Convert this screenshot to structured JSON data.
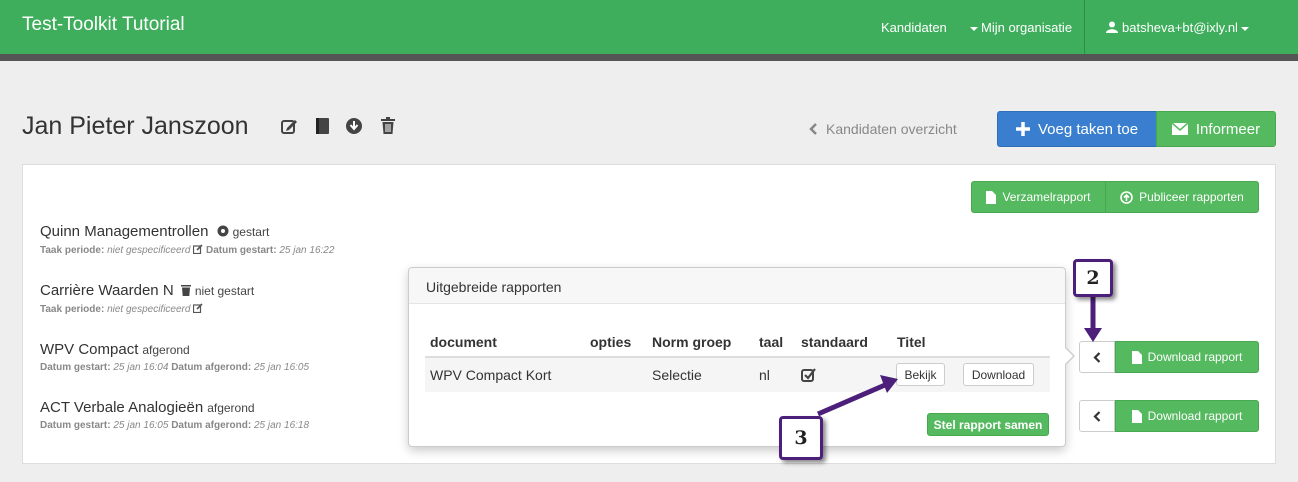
{
  "navbar": {
    "brand": "Test-Toolkit Tutorial",
    "links": {
      "kandidaten": "Kandidaten",
      "organisatie": "Mijn organisatie",
      "user": "batsheva+bt@ixly.nl"
    },
    "color": "#3eae5c"
  },
  "header": {
    "candidate_name": "Jan Pieter Janszoon",
    "icons": [
      "edit-icon",
      "book-icon",
      "download-circle-icon",
      "trash-icon"
    ],
    "back_link": "Kandidaten overzicht",
    "add_tasks_label": "Voeg taken toe",
    "inform_label": "Informeer"
  },
  "panel": {
    "verzamelrapport_label": "Verzamelrapport",
    "publish_label": "Publiceer rapporten",
    "tasks": [
      {
        "title": "Quinn Managementrollen",
        "status": "gestart",
        "meta_1_label": "Taak periode:",
        "meta_1_value": "niet gespecificeerd",
        "meta_2_label": "Datum gestart:",
        "meta_2_value": "25 jan 16:22"
      },
      {
        "title": "Carrière Waarden N",
        "status": "niet gestart",
        "meta_1_label": "Taak periode:",
        "meta_1_value": "niet gespecificeerd"
      },
      {
        "title": "WPV Compact",
        "status": "afgerond",
        "meta_1_label": "Datum gestart:",
        "meta_1_value": "25 jan 16:04",
        "meta_2_label": "Datum afgerond:",
        "meta_2_value": "25 jan 16:05"
      },
      {
        "title": "ACT Verbale Analogieën",
        "status": "afgerond",
        "meta_1_label": "Datum gestart:",
        "meta_1_value": "25 jan 16:05",
        "meta_2_label": "Datum afgerond:",
        "meta_2_value": "25 jan 16:18"
      }
    ],
    "download_report_label": "Download rapport"
  },
  "popover": {
    "title": "Uitgebreide rapporten",
    "columns": [
      "document",
      "opties",
      "Norm groep",
      "taal",
      "standaard",
      "Titel"
    ],
    "row": {
      "document": "WPV Compact Kort",
      "norm_groep": "Selectie",
      "taal": "nl",
      "standaard_checked": true
    },
    "view_label": "Bekijk",
    "download_label": "Download",
    "compose_label": "Stel rapport samen"
  },
  "callouts": {
    "step_2": "2",
    "step_3": "3"
  },
  "colors": {
    "green": "#55b95f",
    "blue": "#3a7fcf",
    "callout_border": "#4b1f7a"
  }
}
